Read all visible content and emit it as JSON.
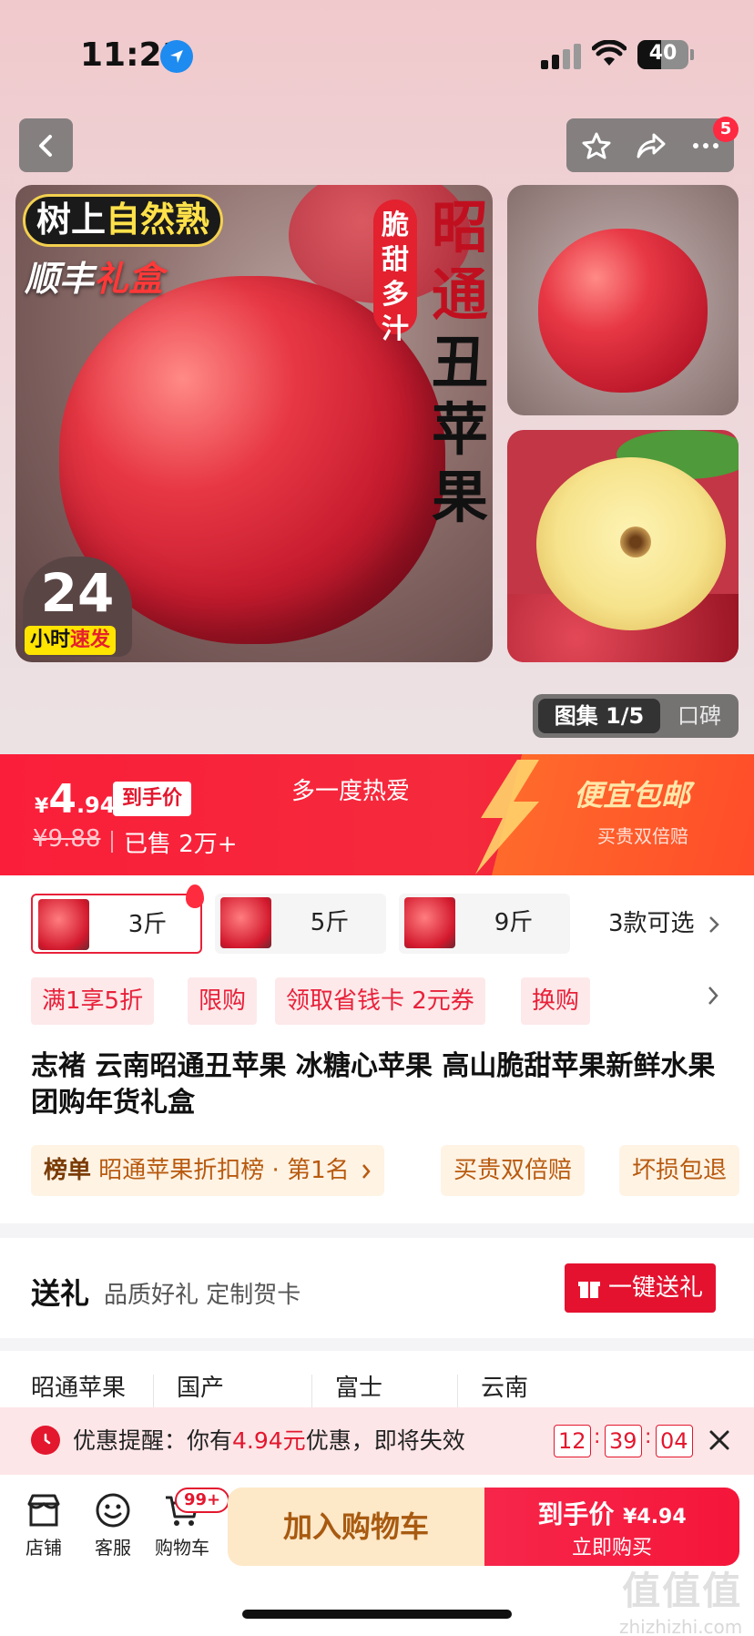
{
  "status_bar": {
    "time": "11:21",
    "battery": "40"
  },
  "header": {
    "more_badge": "5"
  },
  "gallery": {
    "main_tags": {
      "tree_prefix": "树上",
      "tree_highlight": "自然熟",
      "gift_prefix": "顺丰",
      "gift_highlight": "礼盒",
      "juicy": "脆甜多汁",
      "title_red": "昭通",
      "title_dark": "丑苹果",
      "badge_num": "24",
      "badge_ship_prefix": "小时",
      "badge_ship_highlight": "速发"
    },
    "switch_active": "图集 1/5",
    "switch_other": "口碑"
  },
  "price": {
    "currency": "¥",
    "int": "4",
    "dec": ".94",
    "final_tag": "到手价",
    "original": "¥9.88",
    "sold": "已售 2万+",
    "slogan": "多一度热爱",
    "free_ship": "便宜包邮",
    "double_pay": "买贵双倍赔"
  },
  "variants": {
    "items": [
      {
        "label": "3斤",
        "selected": true
      },
      {
        "label": "5斤",
        "selected": false
      },
      {
        "label": "9斤",
        "selected": false
      }
    ],
    "more": "3款可选"
  },
  "promos": [
    "满1享5折",
    "限购",
    "领取省钱卡 2元券",
    "换购"
  ],
  "product": {
    "title": "志褚 云南昭通丑苹果 冰糖心苹果 高山脆甜苹果新鲜水果 团购年货礼盒"
  },
  "chips": {
    "rank_label": "榜单",
    "rank_text": "昭通苹果折扣榜 · 第1名",
    "double_pay": "买贵双倍赔",
    "damage": "坏损包退"
  },
  "gift": {
    "title": "送礼",
    "subtitle": "品质好礼 定制贺卡",
    "button": "一键送礼"
  },
  "attributes": [
    "昭通苹果",
    "国产",
    "富士",
    "云南"
  ],
  "reminder": {
    "prefix": "优惠提醒：你有",
    "amount": "4.94元",
    "suffix": "优惠，即将失效",
    "hh": "12",
    "mm": "39",
    "ss": "04"
  },
  "bottom": {
    "shop": "店铺",
    "service": "客服",
    "cart": "购物车",
    "cart_badge": "99+",
    "add_to_cart": "加入购物车",
    "buy_line1": "到手价",
    "buy_price": "¥4.94",
    "buy_line2": "立即购买"
  },
  "watermark": {
    "big": "值值值",
    "small": "zhizhizhi.com"
  },
  "colors": {
    "accent": "#e3172e",
    "banner": "#fa1e3a",
    "cart_button": "#fde8c8"
  }
}
